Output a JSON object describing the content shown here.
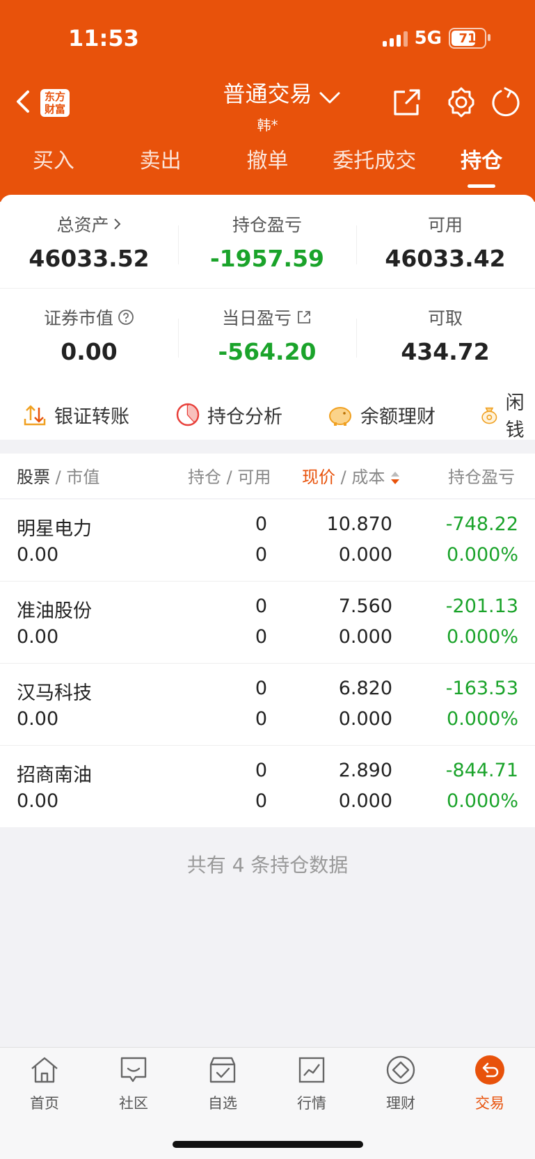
{
  "status": {
    "time": "11:53",
    "network": "5G",
    "battery": "71"
  },
  "header": {
    "logo_line1": "东方",
    "logo_line2": "财富",
    "title": "普通交易",
    "subtitle": "韩*"
  },
  "tabs": [
    "买入",
    "卖出",
    "撤单",
    "委托成交",
    "持仓"
  ],
  "summary": {
    "total_assets_label": "总资产",
    "total_assets": "46033.52",
    "position_pl_label": "持仓盈亏",
    "position_pl": "-1957.59",
    "available_label": "可用",
    "available": "46033.42",
    "market_value_label": "证券市值",
    "market_value": "0.00",
    "daily_pl_label": "当日盈亏",
    "daily_pl": "-564.20",
    "withdrawable_label": "可取",
    "withdrawable": "434.72"
  },
  "quick_actions": [
    "银证转账",
    "持仓分析",
    "余额理财",
    "闲钱"
  ],
  "list_header": {
    "col1_a": "股票",
    "col1_b": "市值",
    "col2_a": "持仓",
    "col2_b": "可用",
    "col3_a": "现价",
    "col3_b": "成本",
    "col4": "持仓盈亏"
  },
  "positions": [
    {
      "name": "明星电力",
      "market_value": "0.00",
      "holding": "0",
      "available": "0",
      "price": "10.870",
      "cost": "0.000",
      "pl": "-748.22",
      "pl_pct": "0.000%"
    },
    {
      "name": "准油股份",
      "market_value": "0.00",
      "holding": "0",
      "available": "0",
      "price": "7.560",
      "cost": "0.000",
      "pl": "-201.13",
      "pl_pct": "0.000%"
    },
    {
      "name": "汉马科技",
      "market_value": "0.00",
      "holding": "0",
      "available": "0",
      "price": "6.820",
      "cost": "0.000",
      "pl": "-163.53",
      "pl_pct": "0.000%"
    },
    {
      "name": "招商南油",
      "market_value": "0.00",
      "holding": "0",
      "available": "0",
      "price": "2.890",
      "cost": "0.000",
      "pl": "-844.71",
      "pl_pct": "0.000%"
    }
  ],
  "footer_text": "共有 4 条持仓数据",
  "tabbar": [
    "首页",
    "社区",
    "自选",
    "行情",
    "理财",
    "交易"
  ],
  "colors": {
    "brand": "#e8520b",
    "loss": "#1aa32a"
  }
}
